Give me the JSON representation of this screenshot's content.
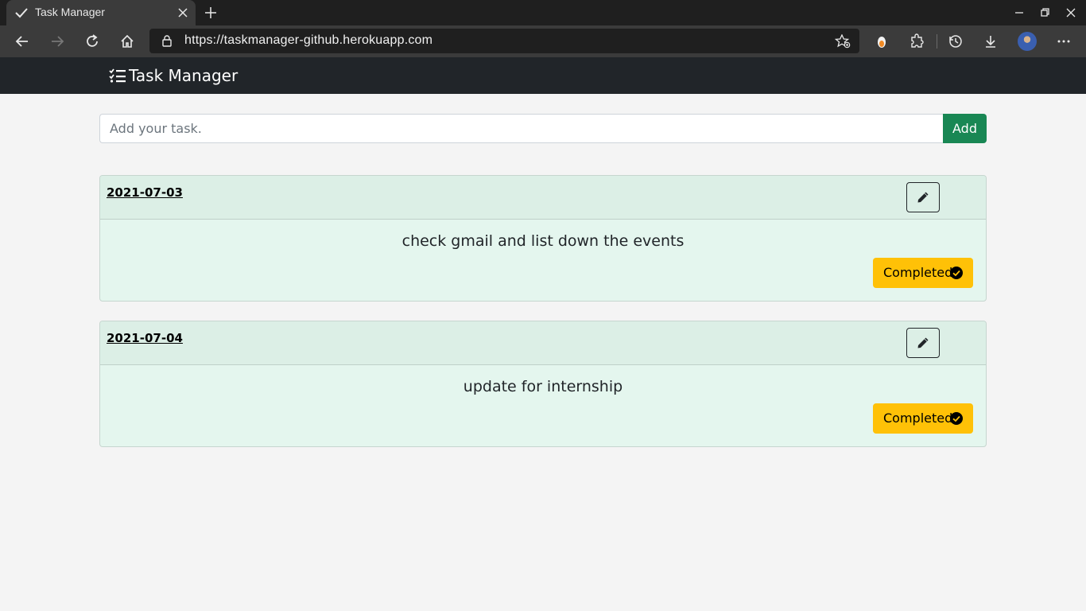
{
  "browser": {
    "tab_title": "Task Manager",
    "url": "https://taskmanager-github.herokuapp.com"
  },
  "navbar": {
    "brand": "Task Manager"
  },
  "add_task": {
    "placeholder": "Add your task.",
    "button_label": "Add"
  },
  "tasks": [
    {
      "date": "2021-07-03",
      "title": "check gmail and list down the events",
      "status": "Completed"
    },
    {
      "date": "2021-07-04",
      "title": "update for internship",
      "status": "Completed"
    }
  ],
  "colors": {
    "navbar": "#212529",
    "add_button": "#198754",
    "status_button": "#ffc107",
    "card_body": "#e4f6ee",
    "card_header": "#dcefe6"
  }
}
